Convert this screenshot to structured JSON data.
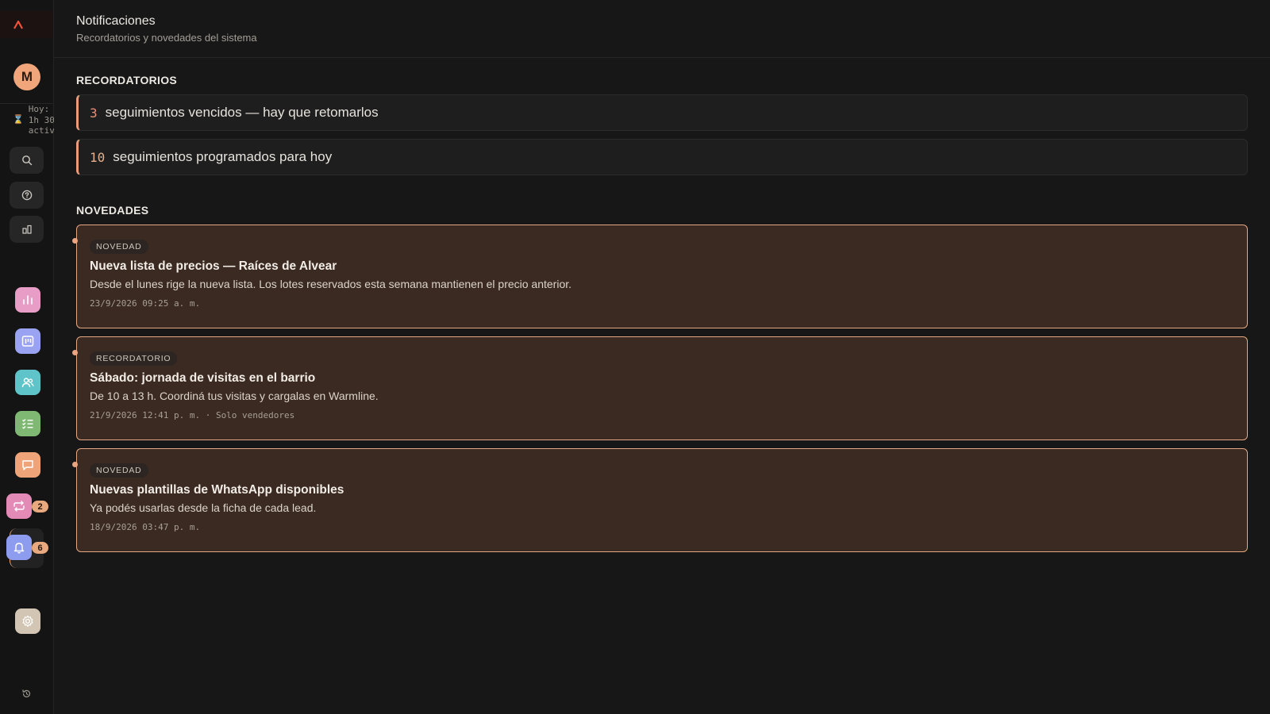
{
  "sidebar": {
    "avatar_initial": "M",
    "today_text": "Hoy:\n1h 30\nactiv",
    "badges": {
      "sync": "2",
      "notifications": "6"
    },
    "colors": {
      "stats": "#e79dc6",
      "board": "#9aa3f2",
      "users": "#5fc4c9",
      "tasks": "#7fb873",
      "chat": "#eea478",
      "sync": "#e48ab6",
      "bell": "#8e9cf0",
      "settings": "#d3c5b3"
    }
  },
  "header": {
    "title": "Notificaciones",
    "subtitle": "Recordatorios y novedades del sistema"
  },
  "reminders": {
    "section_title": "RECORDATORIOS",
    "items": [
      {
        "count": "3",
        "text": "seguimientos vencidos — hay que retomarlos",
        "count_color": "#e8907a"
      },
      {
        "count": "10",
        "text": "seguimientos programados para hoy",
        "count_color": "#e7b08c"
      }
    ]
  },
  "news": {
    "section_title": "NOVEDADES",
    "items": [
      {
        "tag": "NOVEDAD",
        "title": "Nueva lista de precios — Raíces de Alvear",
        "desc": "Desde el lunes rige la nueva lista. Los lotes reservados esta semana mantienen el precio anterior.",
        "meta": "23/9/2026 09:25 a. m."
      },
      {
        "tag": "RECORDATORIO",
        "title": "Sábado: jornada de visitas en el barrio",
        "desc": "De 10 a 13 h. Coordiná tus visitas y cargalas en Warmline.",
        "meta": "21/9/2026 12:41 p. m. · Solo vendedores"
      },
      {
        "tag": "NOVEDAD",
        "title": "Nuevas plantillas de WhatsApp disponibles",
        "desc": "Ya podés usarlas desde la ficha de cada lead.",
        "meta": "18/9/2026 03:47 p. m."
      }
    ]
  }
}
